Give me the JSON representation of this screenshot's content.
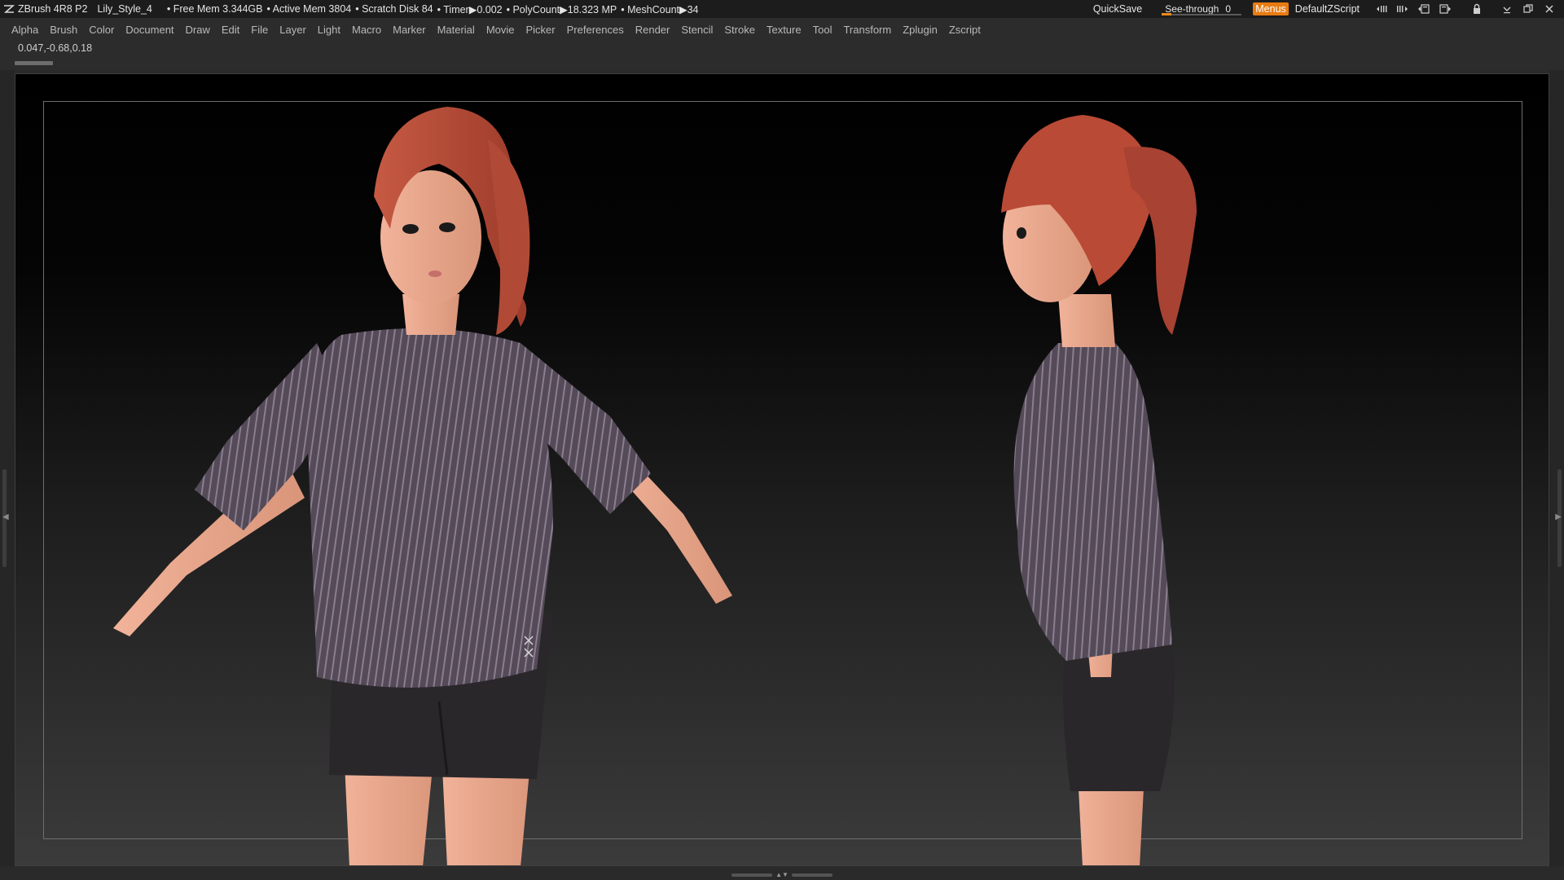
{
  "titlebar": {
    "app": "ZBrush 4R8 P2",
    "document": "Lily_Style_4",
    "stats": [
      "• Free Mem 3.344GB",
      "• Active Mem 3804",
      "• Scratch Disk 84",
      "• Timer▶0.002",
      "• PolyCount▶18.323 MP",
      "• MeshCount▶34"
    ],
    "quicksave": "QuickSave",
    "see_through_label": "See-through",
    "see_through_value": "0",
    "see_through_level": 0,
    "menus_label": "Menus",
    "default_script": "DefaultZScript",
    "accent_color": "#e87b12"
  },
  "menubar": {
    "items": [
      "Alpha",
      "Brush",
      "Color",
      "Document",
      "Draw",
      "Edit",
      "File",
      "Layer",
      "Light",
      "Macro",
      "Marker",
      "Material",
      "Movie",
      "Picker",
      "Preferences",
      "Render",
      "Stencil",
      "Stroke",
      "Texture",
      "Tool",
      "Transform",
      "Zplugin",
      "Zscript"
    ]
  },
  "info": {
    "coords": "0.047,-0.68,0.18"
  },
  "canvas": {
    "subject": "stylized red-haired character, front 3/4 and side views",
    "hair_color": "#b94a36",
    "skin_color": "#e9a88e",
    "shirt_color": "#5a4e5e",
    "shorts_color": "#2a272b"
  }
}
